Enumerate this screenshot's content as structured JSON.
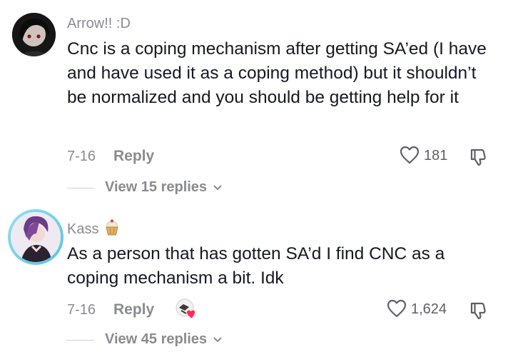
{
  "comments": [
    {
      "username": "Arrow!! :D",
      "text": "Cnc is a coping mechanism after getting SA’ed (I have and have used it as a coping method) but it shouldn’t be normalized and you should be getting help for it",
      "date": "7-16",
      "reply_label": "Reply",
      "likes": "181",
      "view_replies": "View 15 replies"
    },
    {
      "username": "Kass",
      "username_badge_icon": "cupcake-emoji-icon",
      "text": "As a person that has gotten SA’d I find CNC as a coping mechanism a bit. Idk",
      "date": "7-16",
      "reply_label": "Reply",
      "creator_liked_icon": "creator-liked-avatar-icon",
      "likes": "1,624",
      "view_replies": "View 45 replies"
    }
  ],
  "icons": {
    "like": "heart-outline-icon",
    "dislike": "thumbs-down-outline-icon",
    "chevron": "chevron-down-icon"
  },
  "colors": {
    "text": "#161823",
    "muted": "#8a8b91",
    "avatar_ring": "#6fd0e6"
  }
}
